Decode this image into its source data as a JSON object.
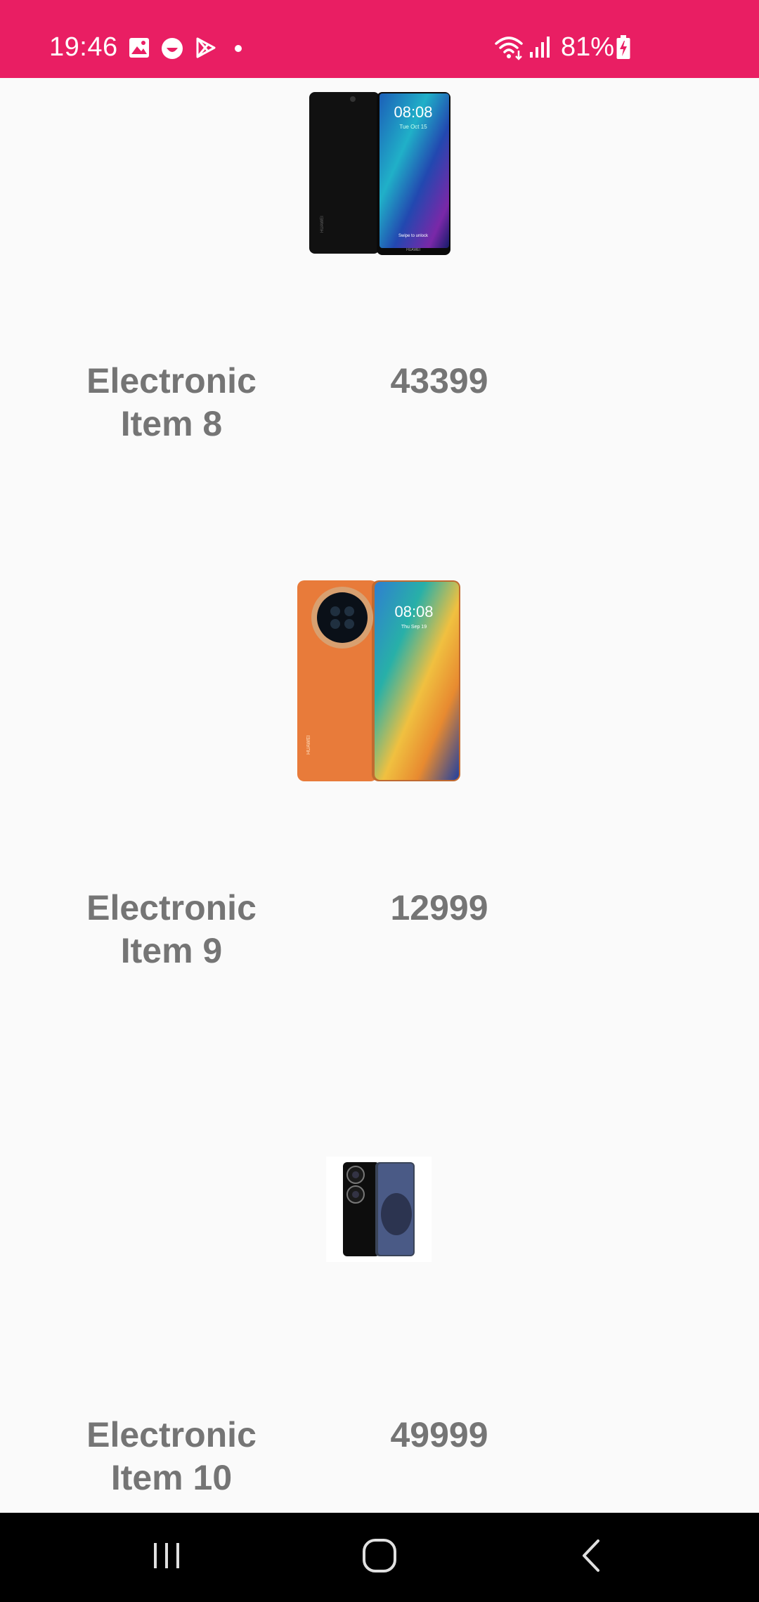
{
  "status_bar": {
    "time": "19:46",
    "battery_percent": "81%",
    "icons": [
      "gallery-icon",
      "face-icon",
      "play-store-icon",
      "notification-dot-icon",
      "wifi-icon",
      "signal-icon",
      "battery-charging-icon"
    ]
  },
  "products": [
    {
      "name": "Electronic\nItem 8",
      "price": "43399",
      "image": "phone-black-blue-icon"
    },
    {
      "name": "Electronic\nItem 9",
      "price": "12999",
      "image": "phone-orange-icon"
    },
    {
      "name": "Electronic\nItem 10",
      "price": "49999",
      "image": "phone-black-silver-icon"
    }
  ],
  "colors": {
    "status_bar": "#e91e63",
    "background": "#fafafa",
    "text": "#757575",
    "nav_bar": "#000000"
  },
  "nav_bar": {
    "buttons": [
      "recent-apps-icon",
      "home-icon",
      "back-icon"
    ]
  }
}
